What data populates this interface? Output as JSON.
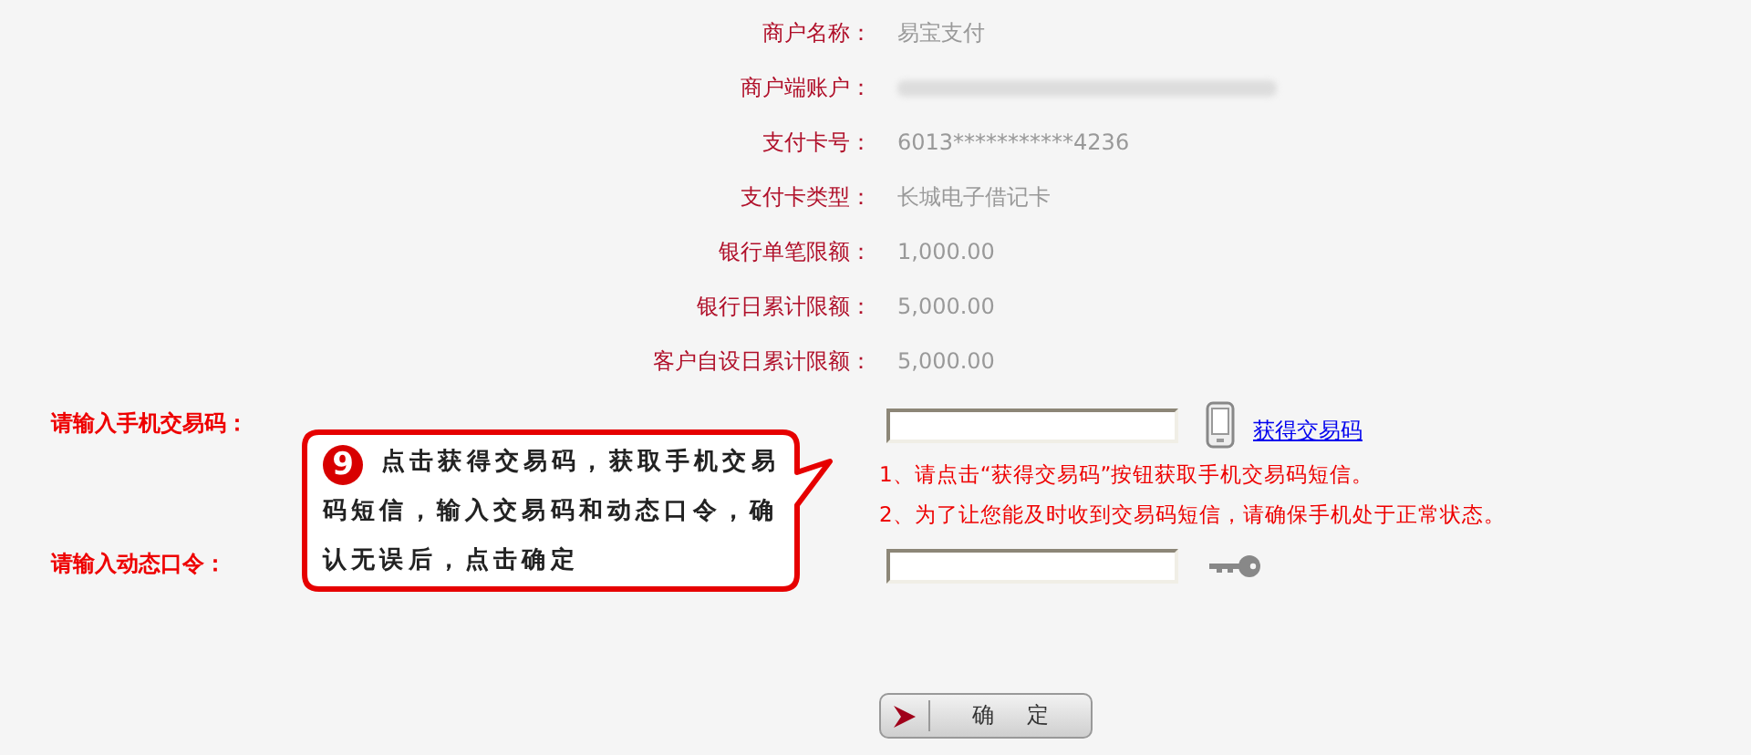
{
  "merchant_info": [
    {
      "label": "商户名称：",
      "kind": "text",
      "value": "易宝支付"
    },
    {
      "label": "商户端账户：",
      "kind": "blurred"
    },
    {
      "label": "支付卡号：",
      "kind": "text",
      "value": "6013***********4236"
    },
    {
      "label": "支付卡类型：",
      "kind": "text",
      "value": "长城电子借记卡"
    },
    {
      "label": "银行单笔限额：",
      "kind": "text",
      "value": "1,000.00"
    },
    {
      "label": "银行日累计限额：",
      "kind": "text",
      "value": "5,000.00"
    },
    {
      "label": "客户自设日累计限额：",
      "kind": "text",
      "value": "5,000.00"
    }
  ],
  "sms_code": {
    "label": "请输入手机交易码：",
    "link": "获得交易码",
    "notes": [
      "1、请点击“获得交易码”按钮获取手机交易码短信。",
      "2、为了让您能及时收到交易码短信，请确保手机处于正常状态。"
    ]
  },
  "dynamic_password": {
    "label": "请输入动态口令："
  },
  "callout": {
    "step": "9",
    "text": "点击获得交易码，获取手机交易码短信，输入交易码和动态口令，确认无误后，点击确定"
  },
  "confirm_button": {
    "label": "确 定"
  }
}
